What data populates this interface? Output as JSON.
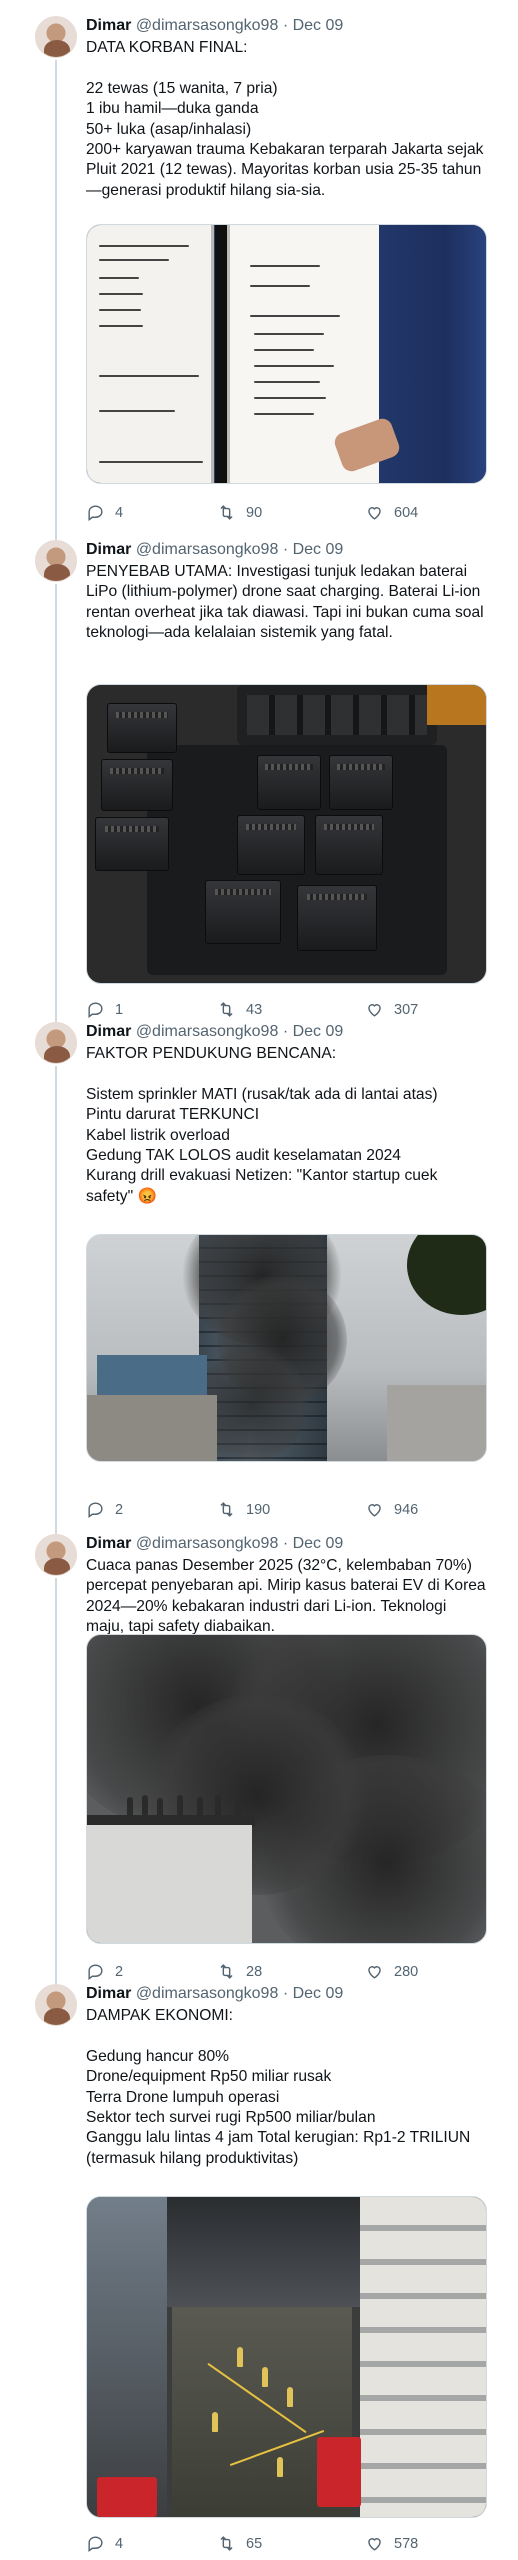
{
  "tweets": [
    {
      "name": "Dimar",
      "handle": "@dimarsasongko98",
      "dot": "·",
      "date": "Dec 09",
      "text": "DATA KORBAN FINAL:\n\n22 tewas (15 wanita, 7 pria)\n1 ibu hamil—duka ganda\n50+ luka (asap/inhalasi)\n200+ karyawan trauma Kebakaran terparah Jakarta sejak Pluit 2021 (12 tewas). Mayoritas korban usia 25-35 tahun—generasi produktif hilang sia-sia.",
      "replies": "4",
      "retweets": "90",
      "likes": "604"
    },
    {
      "name": "Dimar",
      "handle": "@dimarsasongko98",
      "dot": "·",
      "date": "Dec 09",
      "text": "PENYEBAB UTAMA: Investigasi tunjuk ledakan baterai LiPo (lithium-polymer) drone saat charging. Baterai Li-ion rentan overheat jika tak diawasi. Tapi ini bukan cuma soal teknologi—ada kelalaian sistemik yang fatal.",
      "replies": "1",
      "retweets": "43",
      "likes": "307"
    },
    {
      "name": "Dimar",
      "handle": "@dimarsasongko98",
      "dot": "·",
      "date": "Dec 09",
      "text": "FAKTOR PENDUKUNG BENCANA:\n\nSistem sprinkler MATI (rusak/tak ada di lantai atas)\nPintu darurat TERKUNCI\nKabel listrik overload\nGedung TAK LOLOS audit keselamatan 2024\nKurang drill evakuasi Netizen: \"Kantor startup cuek safety\" 😡",
      "replies": "2",
      "retweets": "190",
      "likes": "946"
    },
    {
      "name": "Dimar",
      "handle": "@dimarsasongko98",
      "dot": "·",
      "date": "Dec 09",
      "text": "Cuaca panas Desember 2025 (32°C, kelembaban 70%) percepat penyebaran api. Mirip kasus baterai EV di Korea 2024—20% kebakaran industri dari Li-ion. Teknologi maju, tapi safety diabaikan.",
      "replies": "2",
      "retweets": "28",
      "likes": "280"
    },
    {
      "name": "Dimar",
      "handle": "@dimarsasongko98",
      "dot": "·",
      "date": "Dec 09",
      "text": "DAMPAK EKONOMI:\n\nGedung hancur 80%\nDrone/equipment Rp50 miliar rusak\nTerra Drone lumpuh operasi\nSektor tech survei rugi Rp500 miliar/bulan\nGanggu lalu lintas 4 jam Total kerugian: Rp1-2 TRILIUN (termasuk hilang produktivitas)",
      "replies": "4",
      "retweets": "65",
      "likes": "578"
    }
  ],
  "media_whiteboard_text": {
    "left_board": [
      "Jml Tot Korban Jiwa: 21",
      "21 Lk | 15 Prp",
      "12.45 wib",
      "12.50 wib",
      "13.40 wib",
      "Bangunan sesuai prosedur...",
      "Pasang Jarak terbaer",
      "Asim Evakuasi / Korban"
    ],
    "right_board": [
      "Total Korban: 21 jiwa",
      "Jml Lt 5"
    ]
  },
  "icons": {
    "reply": "reply-icon",
    "retweet": "retweet-icon",
    "like": "heart-icon"
  }
}
